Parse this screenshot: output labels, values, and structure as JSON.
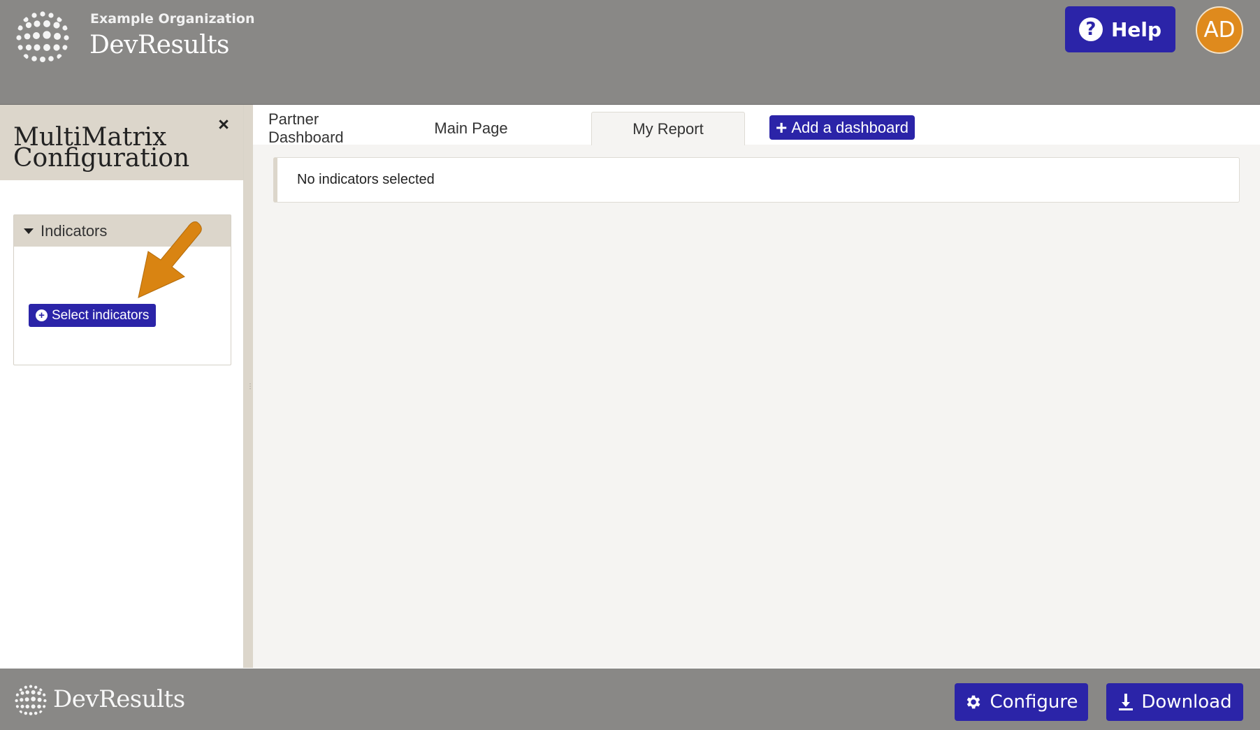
{
  "header": {
    "org_name": "Example Organization",
    "app_name": "DevResults",
    "help_label": "Help",
    "avatar_initials": "AD"
  },
  "sidebar": {
    "title_line1": "MultiMatrix",
    "title_line2": "Configuration",
    "close_icon": "×",
    "panel": {
      "header_label": "Indicators",
      "button_label": "Select indicators"
    }
  },
  "tabs": [
    {
      "label": "Partner Dashboard",
      "active": false
    },
    {
      "label": "Main Page",
      "active": false
    },
    {
      "label": "My Report",
      "active": true
    }
  ],
  "add_dashboard_label": "Add a dashboard",
  "notice_text": "No indicators selected",
  "footer": {
    "brand": "DevResults",
    "configure_label": "Configure",
    "download_label": "Download"
  },
  "colors": {
    "header_bg": "#898886",
    "primary_button": "#2b24a8",
    "avatar": "#df8a1d",
    "annotation_arrow": "#d98412",
    "sidebar_tan": "#dcd6cb"
  },
  "icons": {
    "help": "question-circle-icon",
    "close": "close-icon",
    "caret": "caret-down-icon",
    "select_plus": "plus-circle-icon",
    "add_plus": "plus-icon",
    "configure": "gear-icon",
    "download": "download-icon",
    "logo": "globe-logo-icon"
  }
}
